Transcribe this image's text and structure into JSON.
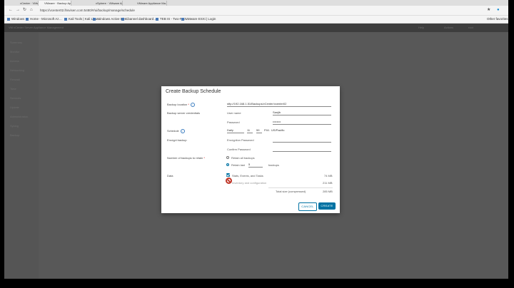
{
  "browser": {
    "tabs": [
      "vCenter · VMware ESX · Com…",
      "VMware · Backup Appliance Ma…",
      "vSphere · VMware Appliance M…",
      "VMware Appliance Ma…"
    ],
    "url": "https://vcenter02.lhsvisen.com:5480/#/ui/backup/manage/schedule",
    "bookmarks": [
      "Windows",
      "Home - Microsoft Az…",
      "Kali Tools | Kali Linu…",
      "Windows Active Dire…",
      "Channel dashboard…",
      "TEB IS - Two-Fact…",
      "VMware ESXi | Login"
    ],
    "other_bookmarks": "Other favorites"
  },
  "app": {
    "header_text": "VM   vCenter Server Appliance Management",
    "header_right": [
      "Help",
      "Actions",
      "root"
    ]
  },
  "sidebar": {
    "items": [
      "Summary",
      "Monitor",
      "Access",
      "Networking",
      "Firewall",
      "Time",
      "Services",
      "Update",
      "Administration",
      "Syslog",
      "Backup"
    ]
  },
  "dialog": {
    "title": "Create Backup Schedule",
    "backup_location_label": "Backup location",
    "backup_location_value": "sftp://192.168.1.51/Backups/vCenter/vcenter02",
    "credentials_label": "Backup server credentials",
    "username_label": "User name",
    "username_value": "Sanjib",
    "password_label": "Password",
    "password_value": "••••••••",
    "schedule_label": "Schedule",
    "schedule_freq": "Daily",
    "schedule_hour": "11",
    "schedule_minute": "59",
    "schedule_ampm": "P.M.",
    "schedule_tz": "US/Pacific",
    "encrypt_label": "Encrypt backup",
    "enc_password_label": "Encryption Password",
    "confirm_password_label": "Confirm Password",
    "retain_label": "Number of backups to retain",
    "retain_all": "Retain all backups",
    "retain_last": "Retain last",
    "retain_count": "5",
    "retain_unit": "backups",
    "data_label": "Data",
    "data_stats": "Stats, Events, and Tasks",
    "data_stats_size": "74 MB",
    "data_inventory": "Inventory and configuration",
    "data_inventory_size": "211 MB",
    "total_label": "Total size (compressed)",
    "total_size": "285 MB",
    "cancel": "CANCEL",
    "create": "CREATE"
  }
}
